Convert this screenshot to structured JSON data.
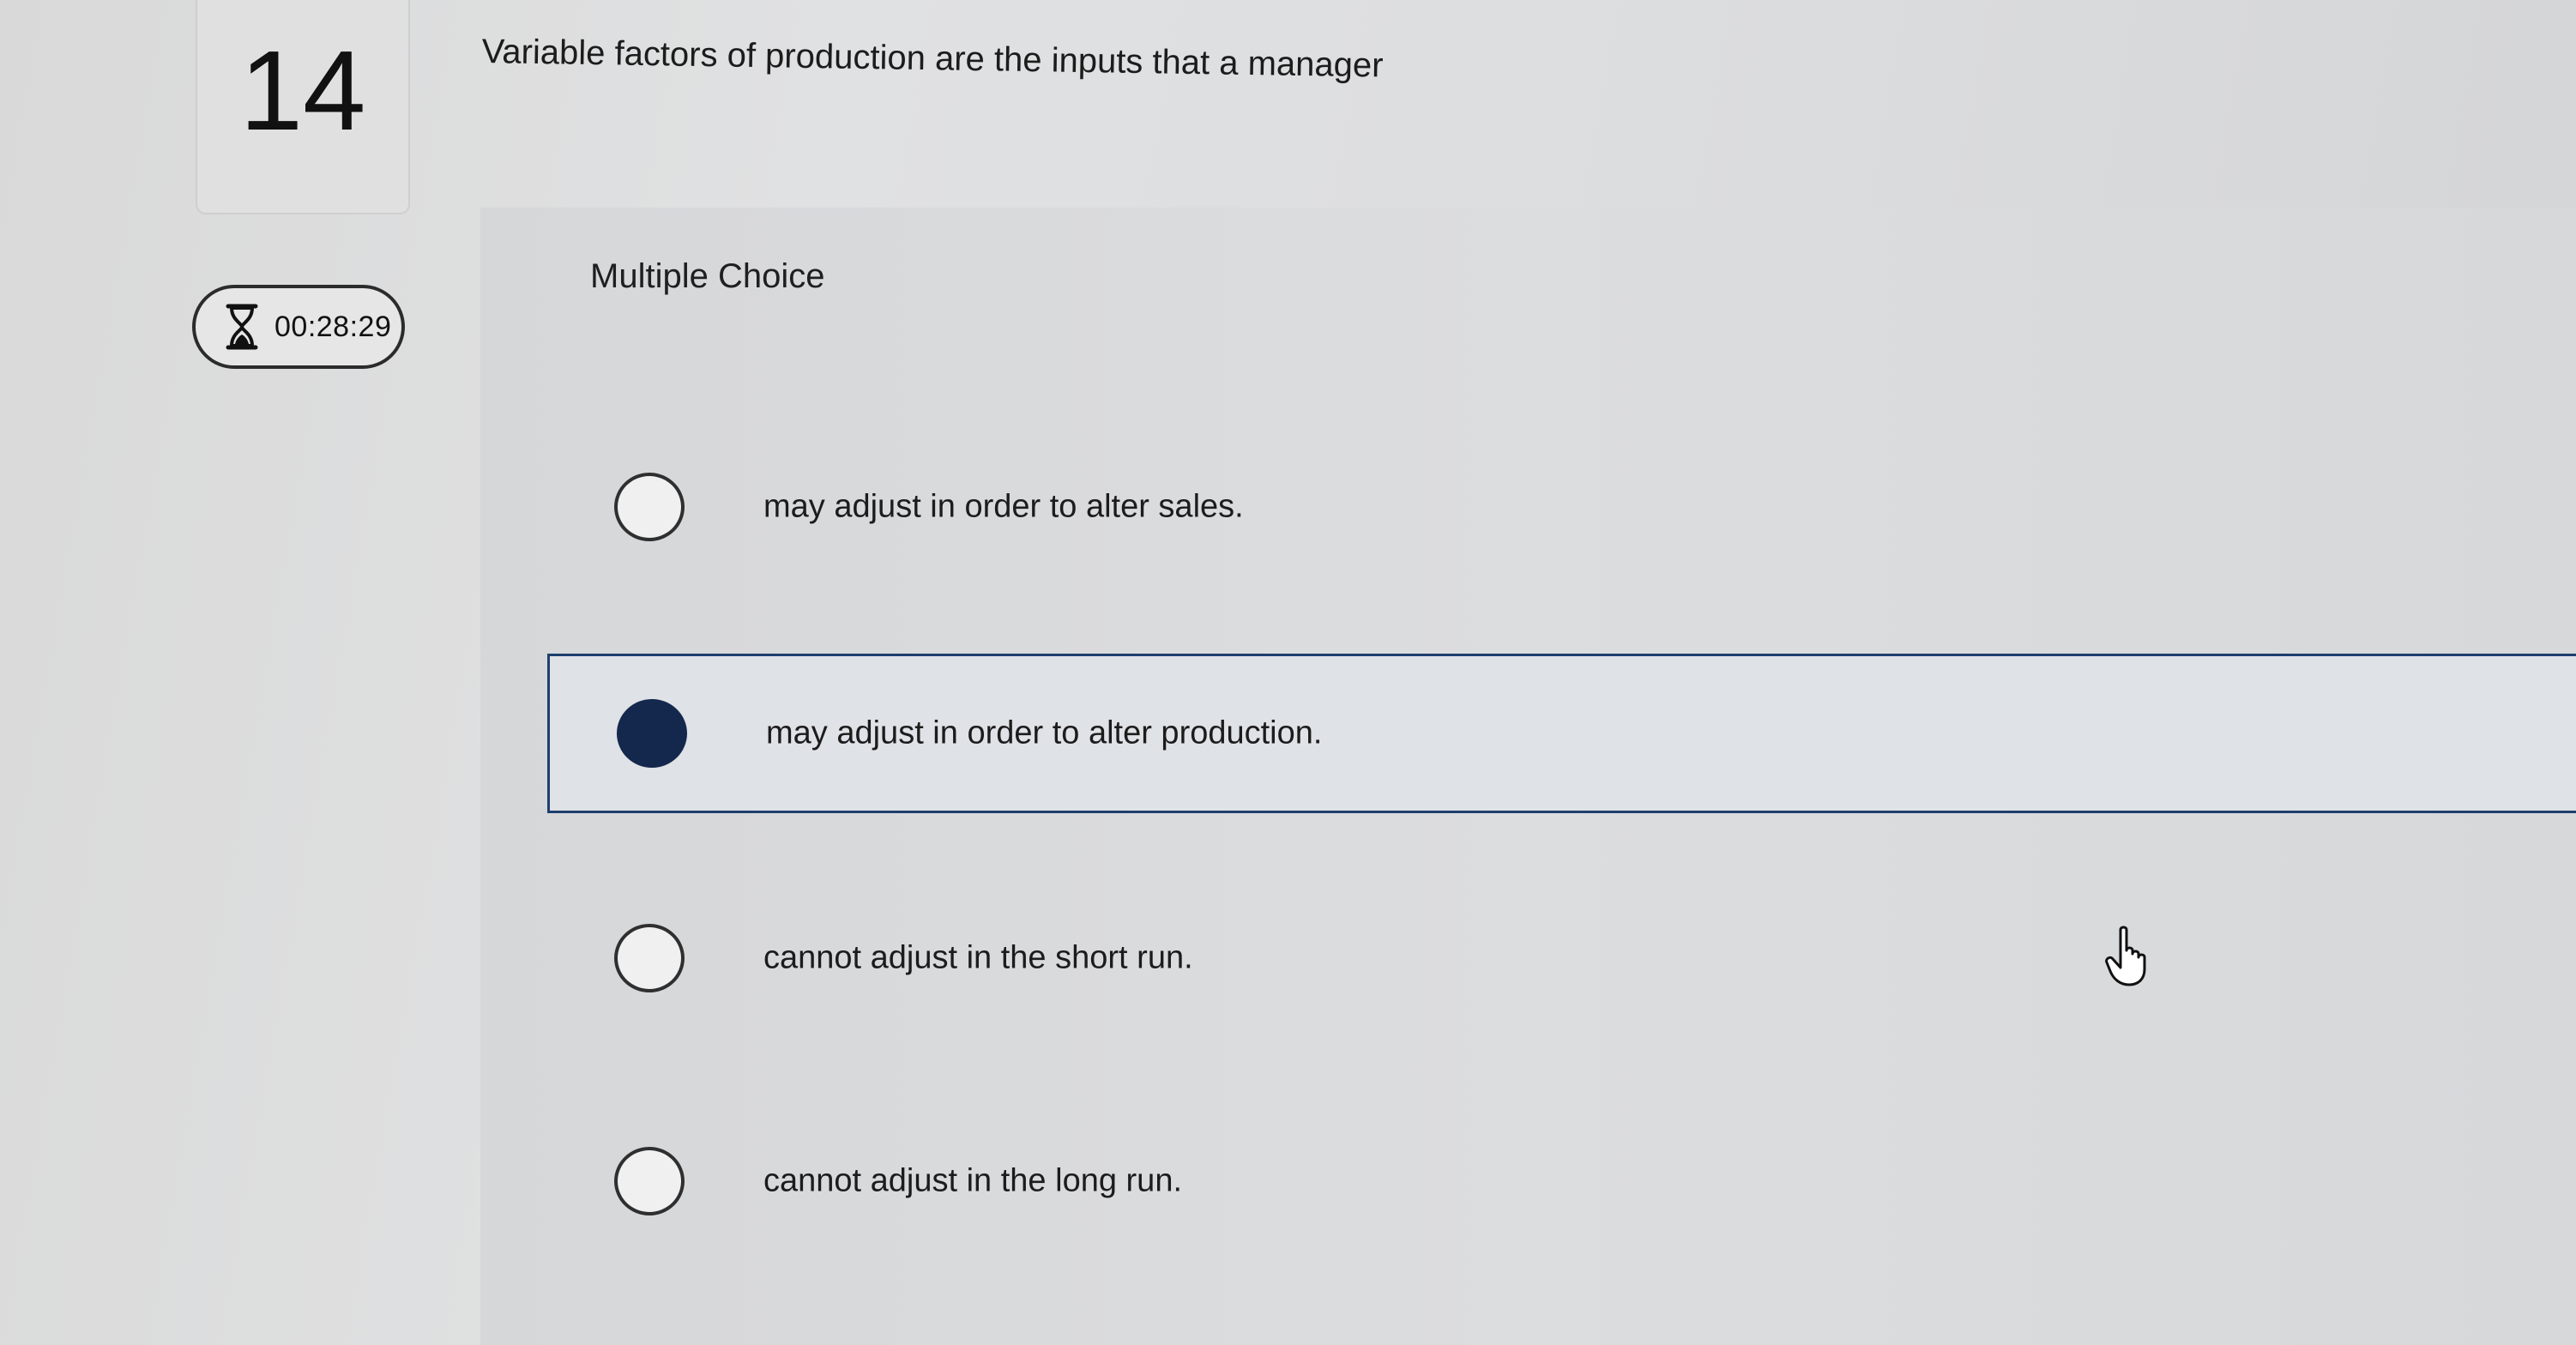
{
  "question_number": "14",
  "timer": {
    "time": "00:28:29",
    "icon": "hourglass-icon"
  },
  "question": {
    "text": "Variable factors of production are the inputs that a manager"
  },
  "question_type": "Multiple Choice",
  "options": [
    {
      "label": "may adjust in order to alter sales.",
      "selected": false
    },
    {
      "label": "may adjust in order to alter production.",
      "selected": true
    },
    {
      "label": "cannot adjust in the short run.",
      "selected": false
    },
    {
      "label": "cannot adjust in the long run.",
      "selected": false
    }
  ],
  "colors": {
    "selected_border": "#1e3f6e",
    "selected_radio": "#14284d",
    "background": "#dcdddf"
  },
  "cursor": {
    "icon": "hand-pointer-icon"
  }
}
